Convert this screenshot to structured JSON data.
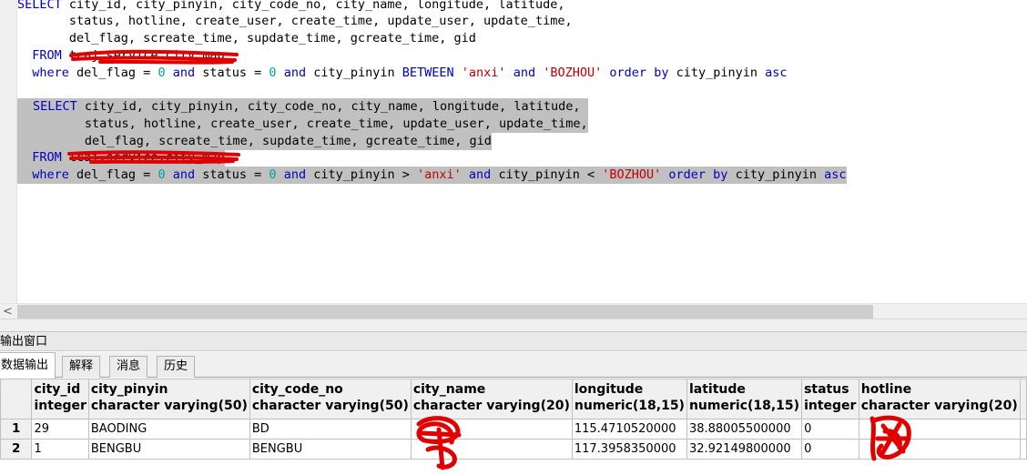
{
  "editor": {
    "query1": {
      "line1": "SELECT city_id, city_pinyin, city_code_no, city_name, longitude, latitude,",
      "line2": "       status, hotline, create_user, create_time, update_user, update_time,",
      "line3": "       del_flag, screate_time, supdate_time, gcreate_time, gid",
      "from_kw": "FROM",
      "table_redacted": "tcaj.service.city_map",
      "where_kw": "where",
      "where_a": " del_flag = ",
      "val0": "0",
      "and_kw": "and",
      "where_b": " status = ",
      "where_c": " city_pinyin ",
      "between_kw": "BETWEEN",
      "str_anxi": "'anxi'",
      "str_bozhou": "'BOZHOU'",
      "order_kw": "order by",
      "order_col": " city_pinyin ",
      "asc_kw": "asc"
    },
    "query2": {
      "line1": "SELECT city_id, city_pinyin, city_code_no, city_name, longitude, latitude,",
      "line2": "       status, hotline, create_user, create_time, update_user, update_time,",
      "line3": "       del_flag, screate_time, supdate_time, gcreate_time, gid",
      "from_kw": "FROM",
      "table_redacted": "tcaj.service.city_map",
      "where_kw": "where",
      "where_a": " del_flag = ",
      "val0": "0",
      "and_kw": "and",
      "where_b": " status = ",
      "where_c": " city_pinyin > ",
      "str_anxi": "'anxi'",
      "where_d": " city_pinyin < ",
      "str_bozhou": "'BOZHOU'",
      "order_kw": "order by",
      "order_col": " city_pinyin ",
      "asc_kw": "asc"
    }
  },
  "scrollbar": {
    "left_arrow": "<"
  },
  "output": {
    "title": "输出窗口",
    "tabs": [
      "数据输出",
      "解释",
      "消息",
      "历史"
    ],
    "active_tab": "数据输出"
  },
  "grid": {
    "columns": [
      {
        "name": "city_id",
        "type": "integer"
      },
      {
        "name": "city_pinyin",
        "type": "character varying(50)"
      },
      {
        "name": "city_code_no",
        "type": "character varying(50)"
      },
      {
        "name": "city_name",
        "type": "character varying(20)"
      },
      {
        "name": "longitude",
        "type": "numeric(18,15)"
      },
      {
        "name": "latitude",
        "type": "numeric(18,15)"
      },
      {
        "name": "status",
        "type": "integer"
      },
      {
        "name": "hotline",
        "type": "character varying(20)"
      }
    ],
    "rows": [
      {
        "num": "1",
        "city_id": "29",
        "city_pinyin": "BAODING",
        "city_code_no": "BD",
        "city_name": "",
        "longitude": "115.4710520000",
        "latitude": "38.88005500000",
        "status": "0",
        "hotline": ""
      },
      {
        "num": "2",
        "city_id": "1",
        "city_pinyin": "BENGBU",
        "city_code_no": "BENGBU",
        "city_name": "",
        "longitude": "117.3958350000",
        "latitude": "32.92149800000",
        "status": "0",
        "hotline": ""
      }
    ]
  },
  "colors": {
    "keyword": "#0000c0",
    "number": "#00a0a0",
    "string": "#c00000",
    "selection": "#c0c0c0",
    "redaction": "#e00000"
  }
}
